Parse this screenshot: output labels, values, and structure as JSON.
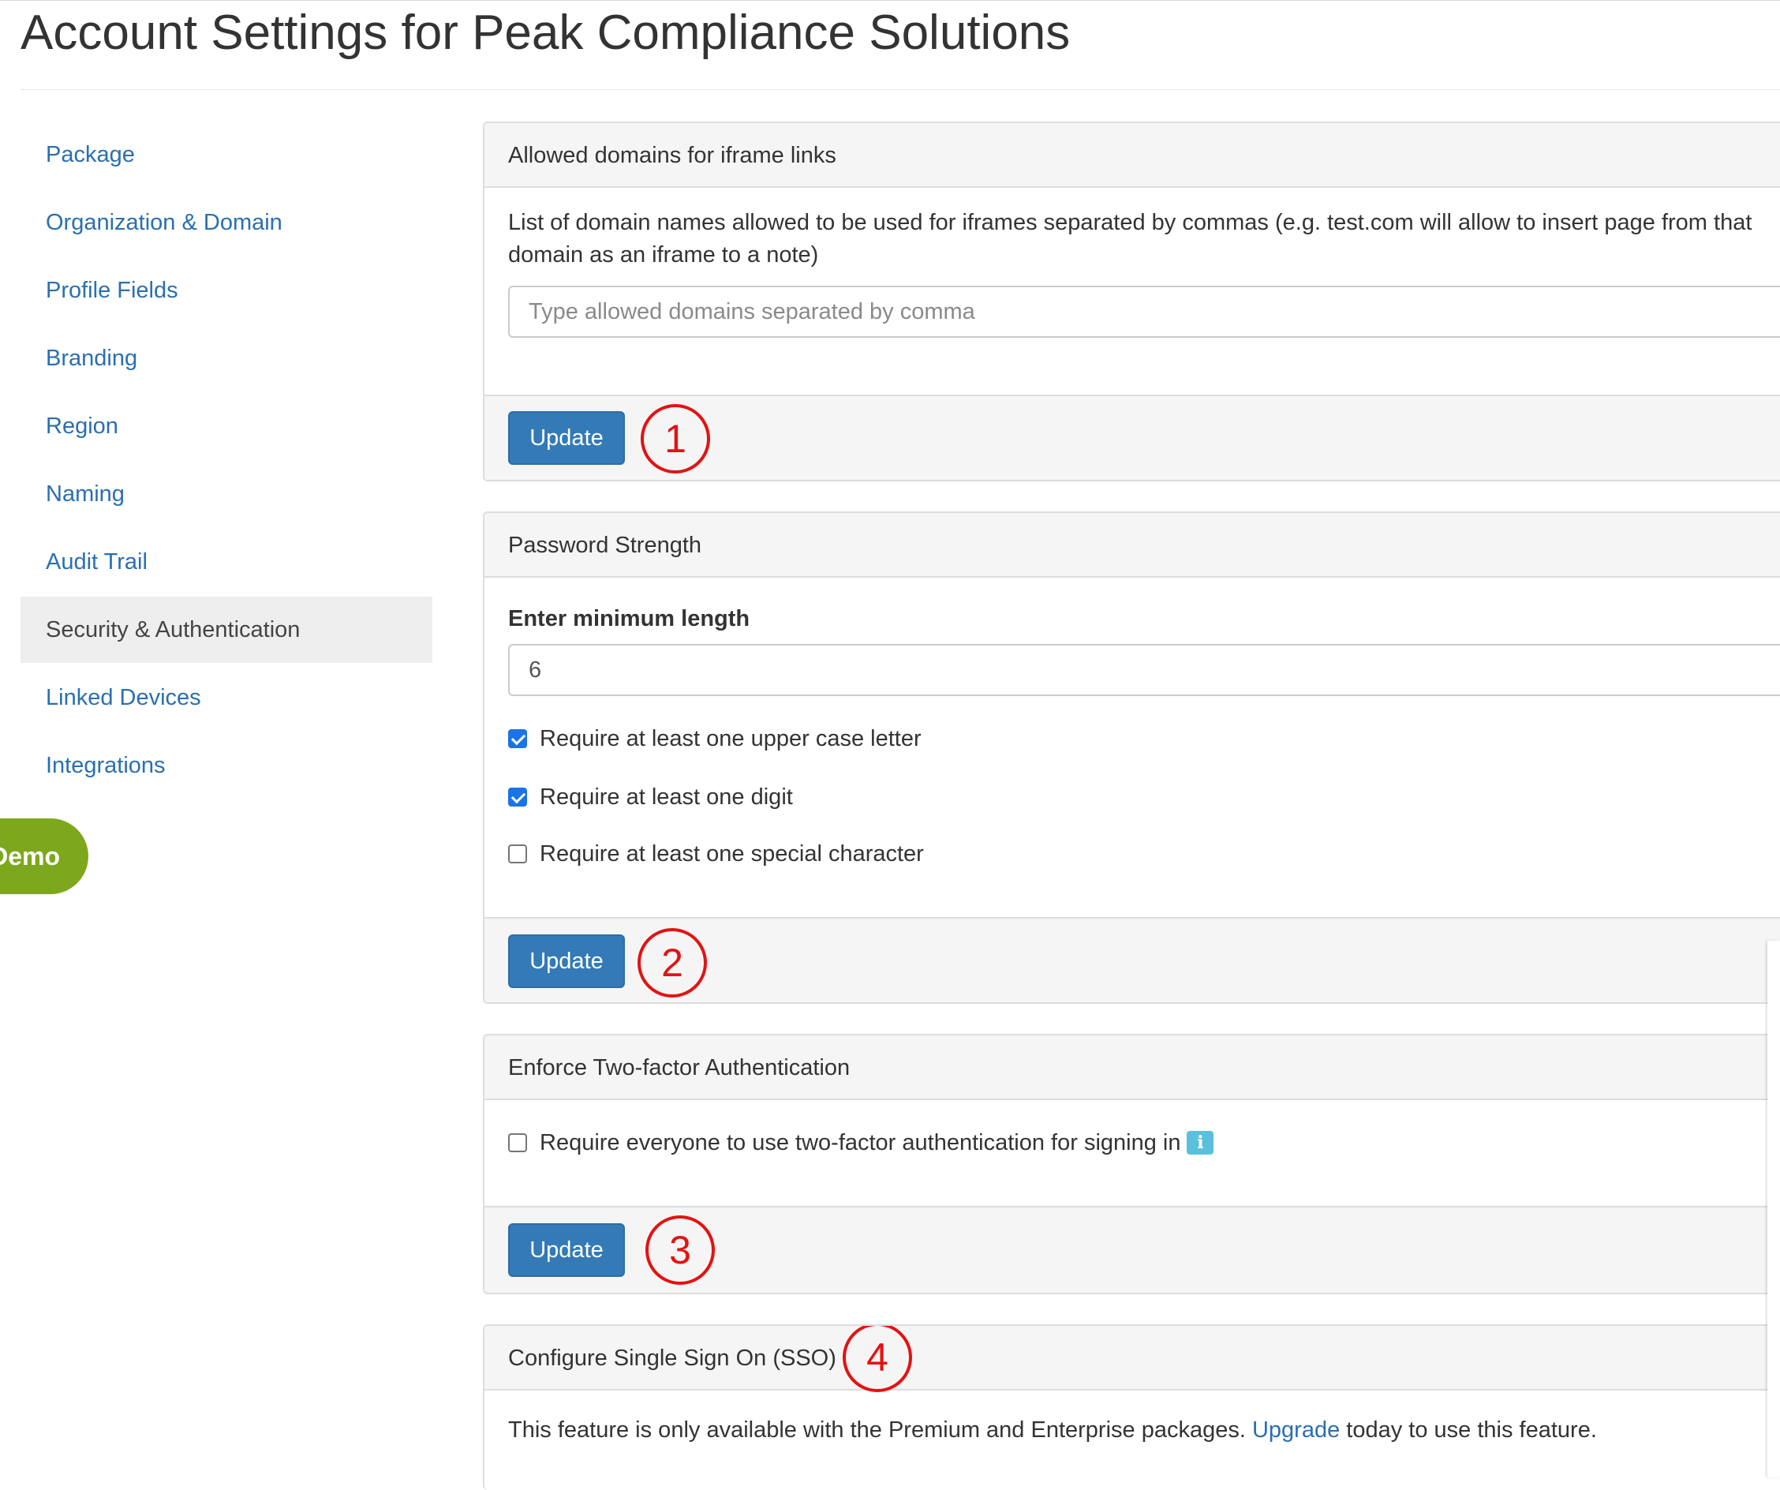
{
  "page": {
    "title": "Account Settings for Peak Compliance Solutions"
  },
  "sidebar": {
    "items": [
      {
        "label": "Package",
        "active": false
      },
      {
        "label": "Organization & Domain",
        "active": false
      },
      {
        "label": "Profile Fields",
        "active": false
      },
      {
        "label": "Branding",
        "active": false
      },
      {
        "label": "Region",
        "active": false
      },
      {
        "label": "Naming",
        "active": false
      },
      {
        "label": "Audit Trail",
        "active": false
      },
      {
        "label": "Security & Authentication",
        "active": true
      },
      {
        "label": "Linked Devices",
        "active": false
      },
      {
        "label": "Integrations",
        "active": false
      }
    ],
    "demo_label": "Demo"
  },
  "iframe_domains": {
    "heading": "Allowed domains for iframe links",
    "description_line1": "List of domain names allowed to be used for iframes separated by commas (e.g. test.com will allow to insert page from that",
    "description_line2": "domain as an iframe to a note)",
    "input_value": "",
    "input_placeholder": "Type allowed domains separated by comma",
    "update_label": "Update",
    "marker": "1"
  },
  "password_strength": {
    "heading": "Password Strength",
    "min_length_label": "Enter minimum length",
    "min_length_value": "6",
    "options": [
      {
        "label": "Require at least one upper case letter",
        "checked": true
      },
      {
        "label": "Require at least one digit",
        "checked": true
      },
      {
        "label": "Require at least one special character",
        "checked": false
      }
    ],
    "update_label": "Update",
    "marker": "2"
  },
  "two_factor": {
    "heading": "Enforce Two-factor Authentication",
    "option_label": "Require everyone to use two-factor authentication for signing in",
    "checked": false,
    "info_icon": "info-icon",
    "info_glyph": "i",
    "update_label": "Update",
    "marker": "3"
  },
  "sso": {
    "heading": "Configure Single Sign On (SSO)",
    "marker": "4",
    "text_before": "This feature is only available with the Premium and Enterprise packages.",
    "link_label": "Upgrade",
    "text_after": "today to use this feature."
  },
  "colors": {
    "link": "#2a6fb0",
    "primary_button": "#337ab7",
    "demo_green": "#7da81d",
    "marker_red": "#e41212",
    "info_blue": "#5bc0de",
    "checkbox_blue": "#1a73e8"
  }
}
